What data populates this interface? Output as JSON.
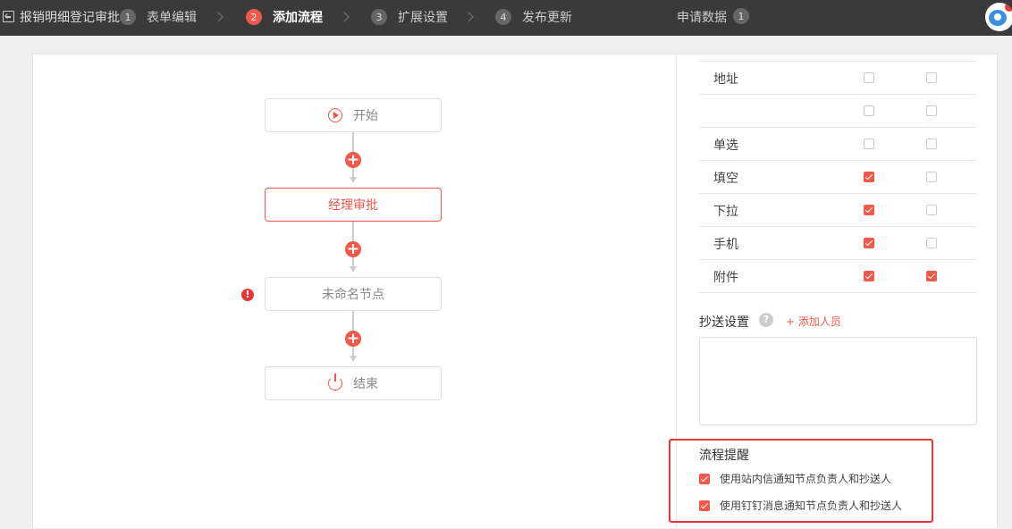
{
  "header": {
    "form_title": "报销明细登记审批",
    "steps": [
      {
        "num": "1",
        "label": "表单编辑",
        "active": false
      },
      {
        "num": "2",
        "label": "添加流程",
        "active": true
      },
      {
        "num": "3",
        "label": "扩展设置",
        "active": false
      },
      {
        "num": "4",
        "label": "发布更新",
        "active": false
      }
    ],
    "data_label": "申请数据",
    "data_count": "1"
  },
  "flow": {
    "nodes": [
      {
        "label": "开始",
        "icon": "play-icon"
      },
      {
        "label": "经理审批",
        "selected": true
      },
      {
        "label": "未命名节点",
        "warning": "!"
      },
      {
        "label": "结束",
        "icon": "power-icon"
      }
    ],
    "add_symbol": "+"
  },
  "fields": [
    {
      "name": "地址",
      "col1": false,
      "col2": false
    },
    {
      "name": "",
      "col1": false,
      "col2": false
    },
    {
      "name": "单选",
      "col1": false,
      "col2": false
    },
    {
      "name": "填空",
      "col1": true,
      "col2": false
    },
    {
      "name": "下拉",
      "col1": true,
      "col2": false
    },
    {
      "name": "手机",
      "col1": true,
      "col2": false
    },
    {
      "name": "附件",
      "col1": true,
      "col2": true
    }
  ],
  "cc": {
    "label": "抄送设置",
    "help": "?",
    "add_label": "+ 添加人员"
  },
  "reminder": {
    "title": "流程提醒",
    "options": [
      {
        "label": "使用站内信通知节点负责人和抄送人",
        "checked": true
      },
      {
        "label": "使用钉钉消息通知节点负责人和抄送人",
        "checked": true
      }
    ]
  },
  "colors": {
    "accent": "#f0594a",
    "topbar": "#3a3a3a",
    "highlight_frame": "#e53935"
  }
}
